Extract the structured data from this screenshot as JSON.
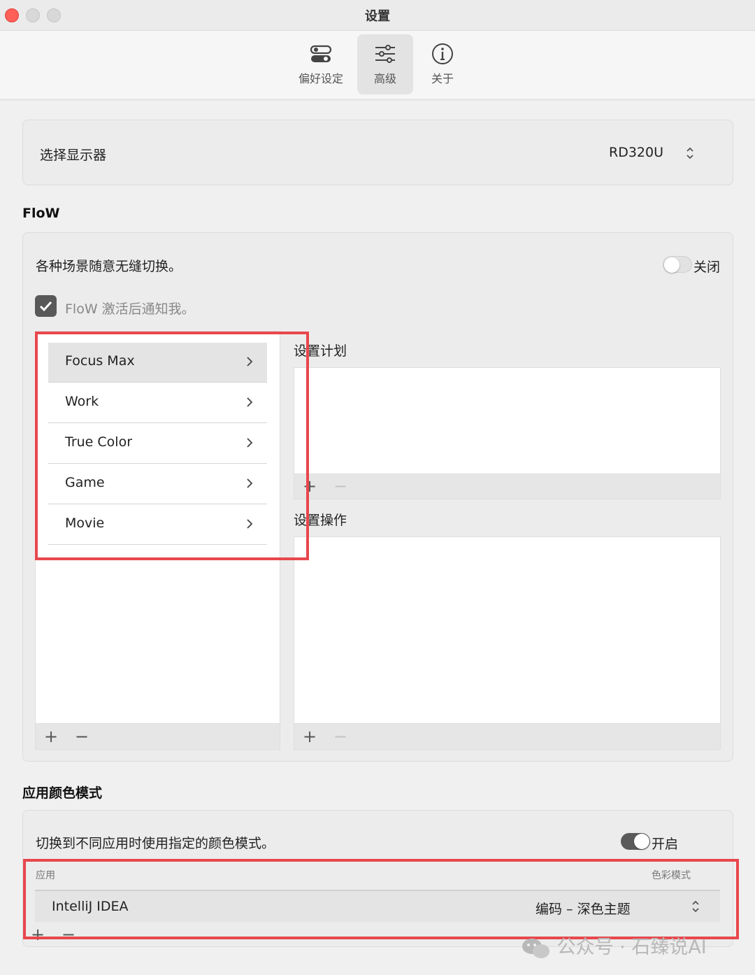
{
  "window": {
    "title": "设置"
  },
  "toolbar": {
    "tabs": [
      {
        "label": "偏好设定",
        "icon": "toggles-icon"
      },
      {
        "label": "高级",
        "icon": "sliders-icon",
        "active": true
      },
      {
        "label": "关于",
        "icon": "info-icon"
      }
    ]
  },
  "display": {
    "label": "选择显示器",
    "value": "RD320U"
  },
  "flow": {
    "title": "FloW",
    "description": "各种场景随意无缝切换。",
    "toggle_label": "关闭",
    "toggle_on": false,
    "notify_label": "FloW 激活后通知我。",
    "notify_checked": true,
    "scenes": [
      "Focus Max",
      "Work",
      "True Color",
      "Game",
      "Movie"
    ],
    "selected_scene": "Focus Max",
    "schedule_label": "设置计划",
    "action_label": "设置操作",
    "add_symbol": "+",
    "remove_symbol": "−"
  },
  "color_mode": {
    "title": "应用颜色模式",
    "description": "切换到不同应用时使用指定的颜色模式。",
    "toggle_label": "开启",
    "toggle_on": true,
    "columns": {
      "app": "应用",
      "mode": "色彩模式"
    },
    "rows": [
      {
        "app": "IntelliJ IDEA",
        "mode": "编码 – 深色主题"
      }
    ]
  },
  "watermark": "公众号 · 石臻说AI",
  "colors": {
    "highlight_box": "#e8474d",
    "close_button": "#fe5f57"
  }
}
